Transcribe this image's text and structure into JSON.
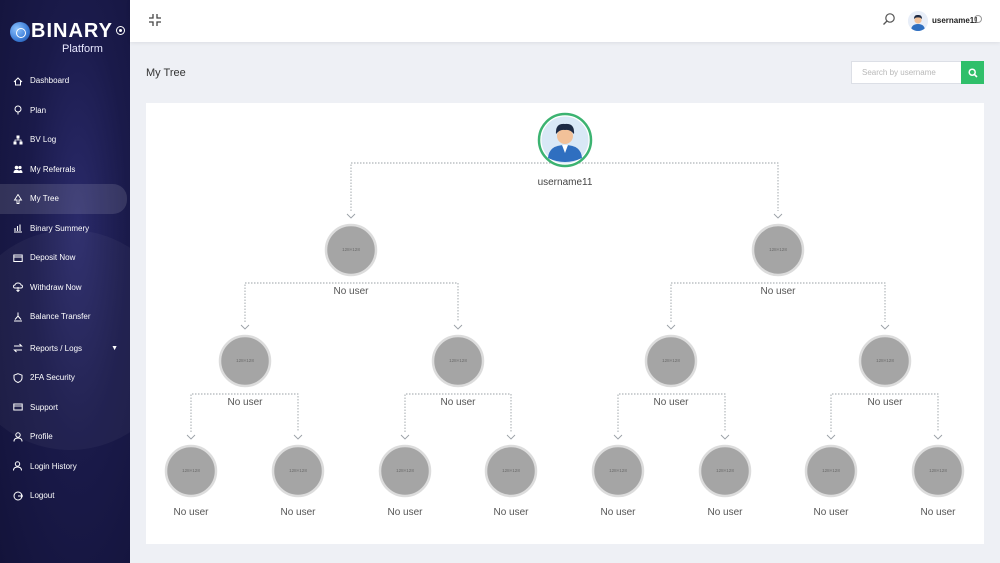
{
  "brand": {
    "title": "BINARY",
    "subtitle": "Platform"
  },
  "sidebar": {
    "items": [
      {
        "label": "Dashboard",
        "icon": "home-icon"
      },
      {
        "label": "Plan",
        "icon": "bulb-icon"
      },
      {
        "label": "BV Log",
        "icon": "sitemap-icon"
      },
      {
        "label": "My Referrals",
        "icon": "users-icon"
      },
      {
        "label": "My Tree",
        "icon": "tree-icon",
        "active": true
      },
      {
        "label": "Binary Summery",
        "icon": "chart-icon"
      },
      {
        "label": "Deposit Now",
        "icon": "wallet-icon"
      },
      {
        "label": "Withdraw Now",
        "icon": "withdraw-icon"
      },
      {
        "label": "Balance Transfer",
        "icon": "transfer-icon"
      },
      {
        "label": "Reports / Logs",
        "icon": "exchange-icon",
        "has_caret": true
      },
      {
        "label": "2FA Security",
        "icon": "shield-icon"
      },
      {
        "label": "Support",
        "icon": "ticket-icon"
      },
      {
        "label": "Profile",
        "icon": "user-icon"
      },
      {
        "label": "Login History",
        "icon": "user-clock-icon"
      },
      {
        "label": "Logout",
        "icon": "logout-icon"
      }
    ]
  },
  "topbar": {
    "username": "username11"
  },
  "page": {
    "title": "My Tree"
  },
  "search": {
    "placeholder": "Search by username"
  },
  "tree": {
    "root": {
      "username": "username11"
    },
    "placeholder_text": "128×128",
    "empty_label": "No user"
  },
  "colors": {
    "accent": "#2fbf6a",
    "sidebar": "#1a1a4a",
    "node": "#a5a5a5"
  }
}
